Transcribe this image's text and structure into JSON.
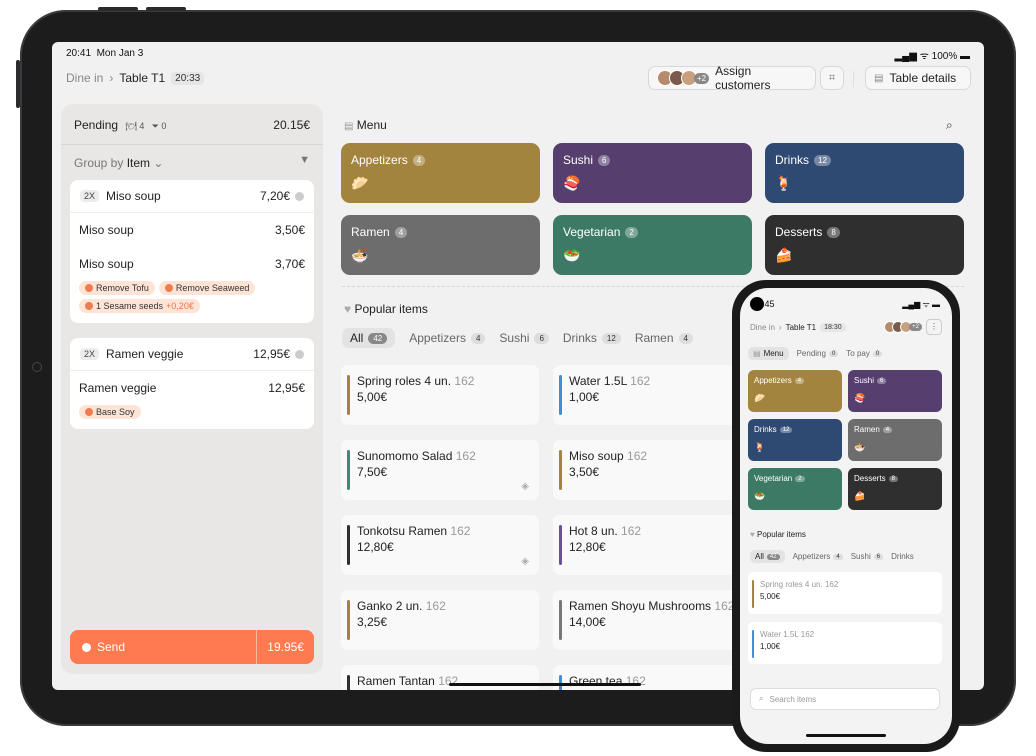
{
  "tablet": {
    "status_time": "20:41",
    "status_date": "Mon Jan 3",
    "battery": "100%",
    "breadcrumb_root": "Dine in",
    "breadcrumb_current": "Table T1",
    "table_time": "20:33",
    "avatar_extra": "+2",
    "assign_customers": "Assign customers",
    "table_details": "Table details"
  },
  "order": {
    "status_label": "Pending",
    "covers": "4",
    "filters": "0",
    "total": "20.15€",
    "group_by_label": "Group by",
    "group_by_value": "Item",
    "items": [
      {
        "qty": "2X",
        "name": "Miso soup",
        "price": "7,20€"
      },
      {
        "qty": "2X",
        "name": "Ramen veggie",
        "price": "12,95€"
      }
    ],
    "lines": [
      {
        "name": "Miso soup",
        "price": "3,50€"
      },
      {
        "name": "Miso soup",
        "price": "3,70€"
      },
      {
        "name": "Ramen veggie",
        "price": "12,95€"
      }
    ],
    "modifiers": {
      "remove_tofu": "Remove Tofu",
      "remove_seaweed": "Remove Seaweed",
      "sesame": "1 Sesame seeds",
      "sesame_extra": "+0,20€",
      "base_soy": "Base Soy"
    },
    "send_label": "Send",
    "send_amount": "19.95€"
  },
  "menu": {
    "title": "Menu",
    "categories": [
      {
        "name": "Appetizers",
        "count": "4",
        "color": "#a3843e",
        "icon": "dumpling-icon"
      },
      {
        "name": "Sushi",
        "count": "6",
        "color": "#563e6f",
        "icon": "sushi-icon"
      },
      {
        "name": "Drinks",
        "count": "12",
        "color": "#2e4a72",
        "icon": "drink-icon"
      },
      {
        "name": "Ramen",
        "count": "4",
        "color": "#6d6d6d",
        "icon": "ramen-icon"
      },
      {
        "name": "Vegetarian",
        "count": "2",
        "color": "#3d7a65",
        "icon": "salad-icon"
      },
      {
        "name": "Desserts",
        "count": "8",
        "color": "#2f2f2f",
        "icon": "cake-icon"
      }
    ],
    "popular_title": "Popular items",
    "tabs": [
      {
        "label": "All",
        "count": "42"
      },
      {
        "label": "Appetizers",
        "count": "4"
      },
      {
        "label": "Sushi",
        "count": "6"
      },
      {
        "label": "Drinks",
        "count": "12"
      },
      {
        "label": "Ramen",
        "count": "4"
      }
    ],
    "items": [
      {
        "name": "Spring roles 4 un.",
        "sold": "162",
        "price": "5,00€",
        "color": "#a3843e"
      },
      {
        "name": "Water 1.5L",
        "sold": "162",
        "price": "1,00€",
        "color": "#3a8fe0"
      },
      {
        "name": "Sunomomo Salad",
        "sold": "162",
        "price": "7,50€",
        "color": "#3d8a78"
      },
      {
        "name": "Miso soup",
        "sold": "162",
        "price": "3,50€",
        "color": "#a3843e"
      },
      {
        "name": "Tonkotsu Ramen",
        "sold": "162",
        "price": "12,80€",
        "color": "#2f2f2f"
      },
      {
        "name": "Hot 8 un.",
        "sold": "162",
        "price": "12,80€",
        "color": "#6b4e9a"
      },
      {
        "name": "Ganko 2 un.",
        "sold": "162",
        "price": "3,25€",
        "color": "#a3843e"
      },
      {
        "name": "Ramen Shoyu Mushrooms",
        "sold": "162",
        "price": "14,00€",
        "color": "#777777"
      },
      {
        "name": "Ramen Tantan",
        "sold": "162",
        "price": "",
        "color": "#2f2f2f"
      },
      {
        "name": "Green tea",
        "sold": "162",
        "price": "",
        "color": "#3a8fe0"
      }
    ]
  },
  "phone": {
    "status_time": ":45",
    "breadcrumb_root": "Dine in",
    "breadcrumb_current": "Table T1",
    "table_time": "18:30",
    "avatar_extra": "+2",
    "tabs": [
      {
        "label": "Menu",
        "count": ""
      },
      {
        "label": "Pending",
        "count": "0"
      },
      {
        "label": "To pay",
        "count": "0"
      }
    ],
    "popular_title": "Popular items",
    "pop_tabs": [
      {
        "label": "All",
        "count": "42"
      },
      {
        "label": "Appetizers",
        "count": "4"
      },
      {
        "label": "Sushi",
        "count": "6"
      },
      {
        "label": "Drinks",
        "count": ""
      }
    ],
    "search_placeholder": "Search items"
  }
}
